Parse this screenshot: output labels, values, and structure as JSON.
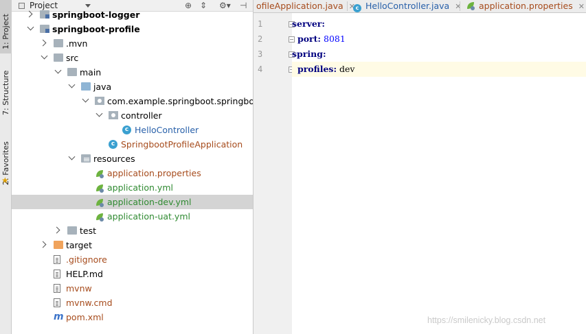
{
  "stripe": {
    "tabs": [
      {
        "label": "1: Project"
      },
      {
        "label": "7: Structure"
      },
      {
        "label": "2: Favorites"
      }
    ]
  },
  "project": {
    "title": "Project",
    "tree": [
      {
        "label": "springboot-logger",
        "indent": 0,
        "arrow": "right",
        "icon": "module-folder-icon",
        "style": "bold"
      },
      {
        "label": "springboot-profile",
        "indent": 0,
        "arrow": "down",
        "icon": "module-folder-icon",
        "style": "bold"
      },
      {
        "label": ".mvn",
        "indent": 1,
        "arrow": "right",
        "icon": "folder-icon",
        "style": "plain"
      },
      {
        "label": "src",
        "indent": 1,
        "arrow": "down",
        "icon": "folder-icon",
        "style": "plain"
      },
      {
        "label": "main",
        "indent": 2,
        "arrow": "down",
        "icon": "folder-icon",
        "style": "plain"
      },
      {
        "label": "java",
        "indent": 3,
        "arrow": "down",
        "icon": "source-folder-icon",
        "style": "plain"
      },
      {
        "label": "com.example.springboot.springboot",
        "indent": 4,
        "arrow": "down",
        "icon": "package-icon",
        "style": "plain"
      },
      {
        "label": "controller",
        "indent": 5,
        "arrow": "down",
        "icon": "package-icon",
        "style": "plain"
      },
      {
        "label": "HelloController",
        "indent": 6,
        "arrow": "",
        "icon": "class-icon",
        "style": "blue"
      },
      {
        "label": "SpringbootProfileApplication",
        "indent": 5,
        "arrow": "",
        "icon": "spring-boot-class-icon",
        "style": "brown"
      },
      {
        "label": "resources",
        "indent": 3,
        "arrow": "down",
        "icon": "resources-folder-icon",
        "style": "plain"
      },
      {
        "label": "application.properties",
        "indent": 4,
        "arrow": "",
        "icon": "spring-config-icon",
        "style": "brown"
      },
      {
        "label": "application.yml",
        "indent": 4,
        "arrow": "",
        "icon": "spring-config-icon",
        "style": "green"
      },
      {
        "label": "application-dev.yml",
        "indent": 4,
        "arrow": "",
        "icon": "spring-config-icon",
        "style": "green",
        "selected": true
      },
      {
        "label": "application-uat.yml",
        "indent": 4,
        "arrow": "",
        "icon": "spring-config-icon",
        "style": "green"
      },
      {
        "label": "test",
        "indent": 2,
        "arrow": "right",
        "icon": "folder-icon",
        "style": "plain"
      },
      {
        "label": "target",
        "indent": 1,
        "arrow": "right",
        "icon": "excluded-folder-icon",
        "style": "plain"
      },
      {
        "label": ".gitignore",
        "indent": 1,
        "arrow": "",
        "icon": "text-file-icon",
        "style": "brown"
      },
      {
        "label": "HELP.md",
        "indent": 1,
        "arrow": "",
        "icon": "text-file-icon",
        "style": "plain"
      },
      {
        "label": "mvnw",
        "indent": 1,
        "arrow": "",
        "icon": "text-file-icon",
        "style": "brown"
      },
      {
        "label": "mvnw.cmd",
        "indent": 1,
        "arrow": "",
        "icon": "text-file-icon",
        "style": "brown"
      },
      {
        "label": "pom.xml",
        "indent": 1,
        "arrow": "",
        "icon": "maven-icon",
        "style": "brown"
      }
    ]
  },
  "editor": {
    "tabs": [
      {
        "label": "ofileApplication.java",
        "icon": "",
        "style": "brown"
      },
      {
        "label": "HelloController.java",
        "icon": "class-icon",
        "style": "blue"
      },
      {
        "label": "application.properties",
        "icon": "spring-config-icon",
        "style": "brown"
      }
    ],
    "lines": [
      {
        "num": "1",
        "key": "server:",
        "value": "",
        "indent": ""
      },
      {
        "num": "2",
        "key": "port:",
        "value": " 8081",
        "indent": "  ",
        "valueType": "number"
      },
      {
        "num": "3",
        "key": "spring:",
        "value": "",
        "indent": ""
      },
      {
        "num": "4",
        "key": "profiles:",
        "value": " dev",
        "indent": "  ",
        "valueType": "text",
        "current": true
      }
    ]
  },
  "watermark": "https://smilenicky.blog.csdn.net"
}
